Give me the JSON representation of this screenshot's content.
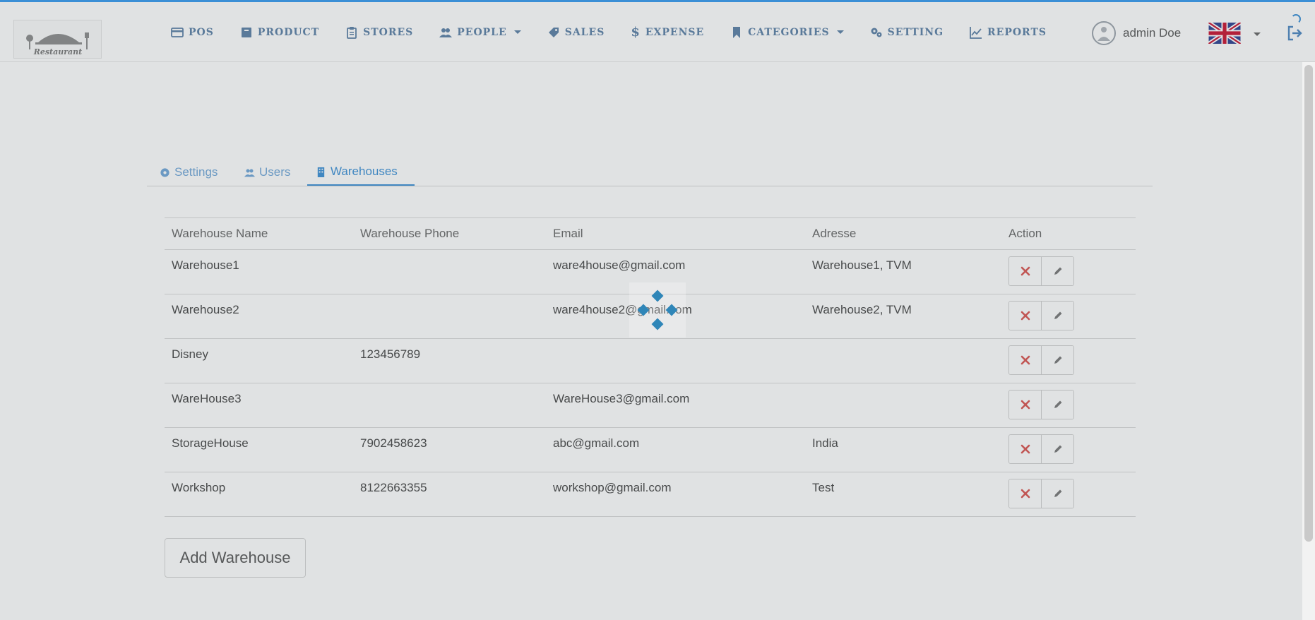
{
  "nav": {
    "items": [
      {
        "label": "POS",
        "icon": "credit-card-icon"
      },
      {
        "label": "PRODUCT",
        "icon": "archive-icon"
      },
      {
        "label": "STORES",
        "icon": "clipboard-icon"
      },
      {
        "label": "PEOPLE",
        "icon": "users-icon",
        "dropdown": true
      },
      {
        "label": "SALES",
        "icon": "tag-icon"
      },
      {
        "label": "EXPENSE",
        "icon": "dollar-icon"
      },
      {
        "label": "CATEGORIES",
        "icon": "bookmark-icon",
        "dropdown": true
      },
      {
        "label": "SETTING",
        "icon": "gears-icon"
      },
      {
        "label": "REPORTS",
        "icon": "line-chart-icon"
      }
    ],
    "user_name": "admin Doe",
    "language_flag": "uk-flag-icon"
  },
  "tabs": [
    {
      "label": "Settings",
      "icon": "gear-icon",
      "active": false
    },
    {
      "label": "Users",
      "icon": "users-icon",
      "active": false
    },
    {
      "label": "Warehouses",
      "icon": "building-icon",
      "active": true
    }
  ],
  "table": {
    "headers": [
      "Warehouse Name",
      "Warehouse Phone",
      "Email",
      "Adresse",
      "Action"
    ],
    "rows": [
      {
        "name": "Warehouse1",
        "phone": "",
        "email": "ware4house@gmail.com",
        "address": "Warehouse1, TVM"
      },
      {
        "name": "Warehouse2",
        "phone": "",
        "email": "ware4house2@gmail.com",
        "address": "Warehouse2, TVM"
      },
      {
        "name": "Disney",
        "phone": "123456789",
        "email": "",
        "address": ""
      },
      {
        "name": "WareHouse3",
        "phone": "",
        "email": "WareHouse3@gmail.com",
        "address": ""
      },
      {
        "name": "StorageHouse",
        "phone": "7902458623",
        "email": "abc@gmail.com",
        "address": "India"
      },
      {
        "name": "Workshop",
        "phone": "8122663355",
        "email": "workshop@gmail.com",
        "address": "Test"
      }
    ],
    "row_actions": [
      {
        "icon": "close-icon",
        "color": "#d9534f"
      },
      {
        "icon": "pencil-icon",
        "color": "#777777"
      }
    ]
  },
  "add_button_label": "Add Warehouse",
  "logo_text": "Restaurant",
  "colors": {
    "accent": "#3b8fd6",
    "nav_text": "#5b7fa6",
    "loader": "#2f86b8"
  }
}
